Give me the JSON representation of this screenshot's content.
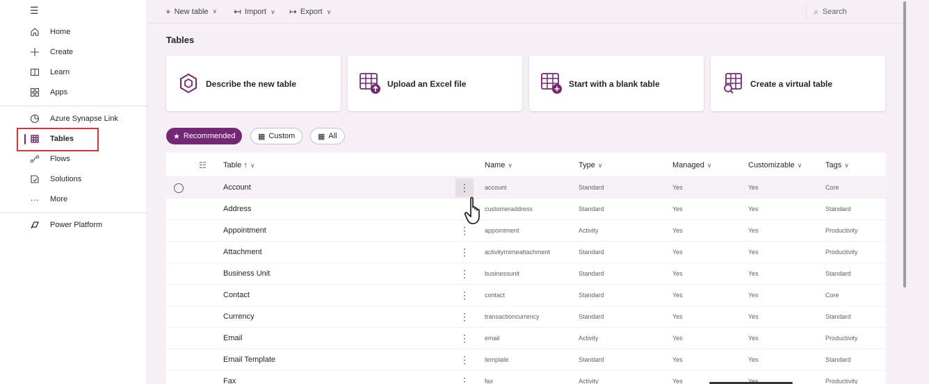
{
  "sidebar": {
    "items": [
      {
        "label": "Home",
        "icon": "home-icon"
      },
      {
        "label": "Create",
        "icon": "plus-icon"
      },
      {
        "label": "Learn",
        "icon": "book-icon"
      },
      {
        "label": "Apps",
        "icon": "apps-icon"
      },
      {
        "label": "Azure Synapse Link",
        "icon": "synapse-icon"
      },
      {
        "label": "Tables",
        "icon": "grid-icon",
        "selected": true
      },
      {
        "label": "Flows",
        "icon": "flow-icon"
      },
      {
        "label": "Solutions",
        "icon": "solutions-icon"
      },
      {
        "label": "More",
        "icon": "ellipsis-icon"
      },
      {
        "label": "Power Platform",
        "icon": "power-platform-icon"
      }
    ]
  },
  "toolbar": {
    "new_table": "New table",
    "import": "Import",
    "export": "Export",
    "search": "Search"
  },
  "page": {
    "title": "Tables"
  },
  "cards": [
    {
      "label": "Describe the new table",
      "icon": "copilot-icon"
    },
    {
      "label": "Upload an Excel file",
      "icon": "upload-table-icon"
    },
    {
      "label": "Start with a blank table",
      "icon": "add-table-icon"
    },
    {
      "label": "Create a virtual table",
      "icon": "virtual-table-icon"
    }
  ],
  "filters": {
    "recommended": "Recommended",
    "custom": "Custom",
    "all": "All",
    "active": "Recommended"
  },
  "table": {
    "columns": {
      "table": "Table",
      "sort_indicator": "↑",
      "name": "Name",
      "type": "Type",
      "managed": "Managed",
      "customizable": "Customizable",
      "tags": "Tags"
    },
    "rows": [
      {
        "table": "Account",
        "name": "account",
        "type": "Standard",
        "managed": "Yes",
        "customizable": "Yes",
        "tags": "Core"
      },
      {
        "table": "Address",
        "name": "customeraddress",
        "type": "Standard",
        "managed": "Yes",
        "customizable": "Yes",
        "tags": "Standard"
      },
      {
        "table": "Appointment",
        "name": "appointment",
        "type": "Activity",
        "managed": "Yes",
        "customizable": "Yes",
        "tags": "Productivity"
      },
      {
        "table": "Attachment",
        "name": "activitymimeattachment",
        "type": "Standard",
        "managed": "Yes",
        "customizable": "Yes",
        "tags": "Productivity"
      },
      {
        "table": "Business Unit",
        "name": "businessunit",
        "type": "Standard",
        "managed": "Yes",
        "customizable": "Yes",
        "tags": "Standard"
      },
      {
        "table": "Contact",
        "name": "contact",
        "type": "Standard",
        "managed": "Yes",
        "customizable": "Yes",
        "tags": "Core"
      },
      {
        "table": "Currency",
        "name": "transactioncurrency",
        "type": "Standard",
        "managed": "Yes",
        "customizable": "Yes",
        "tags": "Standard"
      },
      {
        "table": "Email",
        "name": "email",
        "type": "Activity",
        "managed": "Yes",
        "customizable": "Yes",
        "tags": "Productivity"
      },
      {
        "table": "Email Template",
        "name": "template",
        "type": "Standard",
        "managed": "Yes",
        "customizable": "Yes",
        "tags": "Standard"
      },
      {
        "table": "Fax",
        "name": "fax",
        "type": "Activity",
        "managed": "Yes",
        "customizable": "Yes",
        "tags": "Productivity"
      }
    ]
  },
  "colors": {
    "accent": "#742774",
    "highlight": "#e03030",
    "background": "#f6eff6"
  }
}
